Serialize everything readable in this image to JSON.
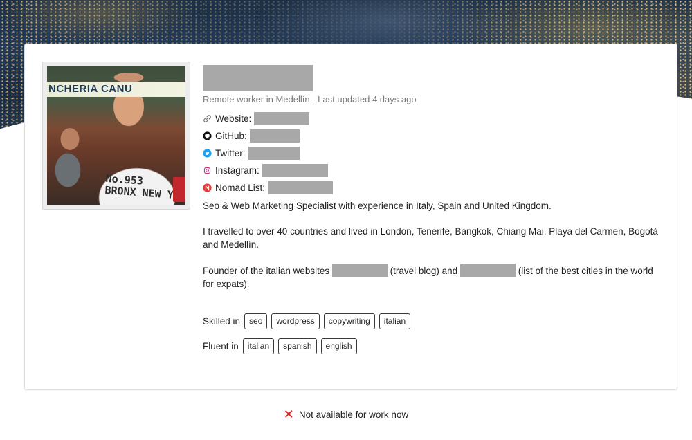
{
  "profile": {
    "subtitle": "Remote worker in Medellín - Last updated 4 days ago",
    "photo": {
      "sign_text": "NCHERIA CANU",
      "shirt_line1": "No.953",
      "shirt_line2": "BRONX NEW YO"
    },
    "links": [
      {
        "label": "Website:",
        "icon": "link-icon",
        "color": "#7a7a7a"
      },
      {
        "label": "GitHub:",
        "icon": "github-icon",
        "color": "#111111"
      },
      {
        "label": "Twitter:",
        "icon": "twitter-icon",
        "color": "#1da1f2"
      },
      {
        "label": "Instagram:",
        "icon": "instagram-icon",
        "color": "#c13584"
      },
      {
        "label": "Nomad List:",
        "icon": "nomadlist-icon",
        "color": "#e03b3b"
      }
    ],
    "bio": {
      "paragraph1": "Seo & Web Marketing Specialist with experience in Italy, Spain and United Kingdom.",
      "paragraph2": "I travelled to over 40 countries and lived in London, Tenerife, Bangkok, Chiang Mai, Playa del Carmen, Bogotà and Medellín.",
      "paragraph3_part1": "Founder of the italian websites",
      "paragraph3_part2": "(travel blog) and",
      "paragraph3_part3": "(list of the best cities in the world for expats)."
    },
    "skills": {
      "label": "Skilled in",
      "items": [
        "seo",
        "wordpress",
        "copywriting",
        "italian"
      ]
    },
    "languages": {
      "label": "Fluent in",
      "items": [
        "italian",
        "spanish",
        "english"
      ]
    }
  },
  "availability": {
    "icon": "cross-icon",
    "text": "Not available for work now",
    "color": "#e02020"
  }
}
